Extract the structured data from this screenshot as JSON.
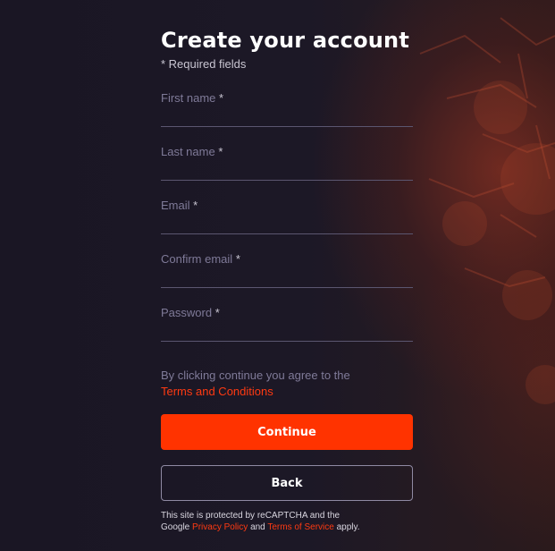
{
  "form": {
    "title": "Create your account",
    "required_note": "* Required fields",
    "fields": [
      {
        "label": "First name",
        "required_mark": "*",
        "value": ""
      },
      {
        "label": "Last name",
        "required_mark": "*",
        "value": ""
      },
      {
        "label": "Email",
        "required_mark": "*",
        "value": ""
      },
      {
        "label": "Confirm email",
        "required_mark": "*",
        "value": ""
      },
      {
        "label": "Password",
        "required_mark": "*",
        "value": ""
      }
    ],
    "agreement": {
      "text": "By clicking continue you agree to the",
      "link": "Terms and Conditions"
    },
    "continue_label": "Continue",
    "back_label": "Back",
    "legal": {
      "line1": "This site is protected by reCAPTCHA and the",
      "google": "Google",
      "privacy_link": "Privacy Policy",
      "and": "and",
      "terms_link": "Terms of Service",
      "apply": "apply."
    }
  },
  "colors": {
    "accent": "#ff3300",
    "background": "#1b1725",
    "label": "#7f7a98",
    "underline": "#5b5670"
  }
}
